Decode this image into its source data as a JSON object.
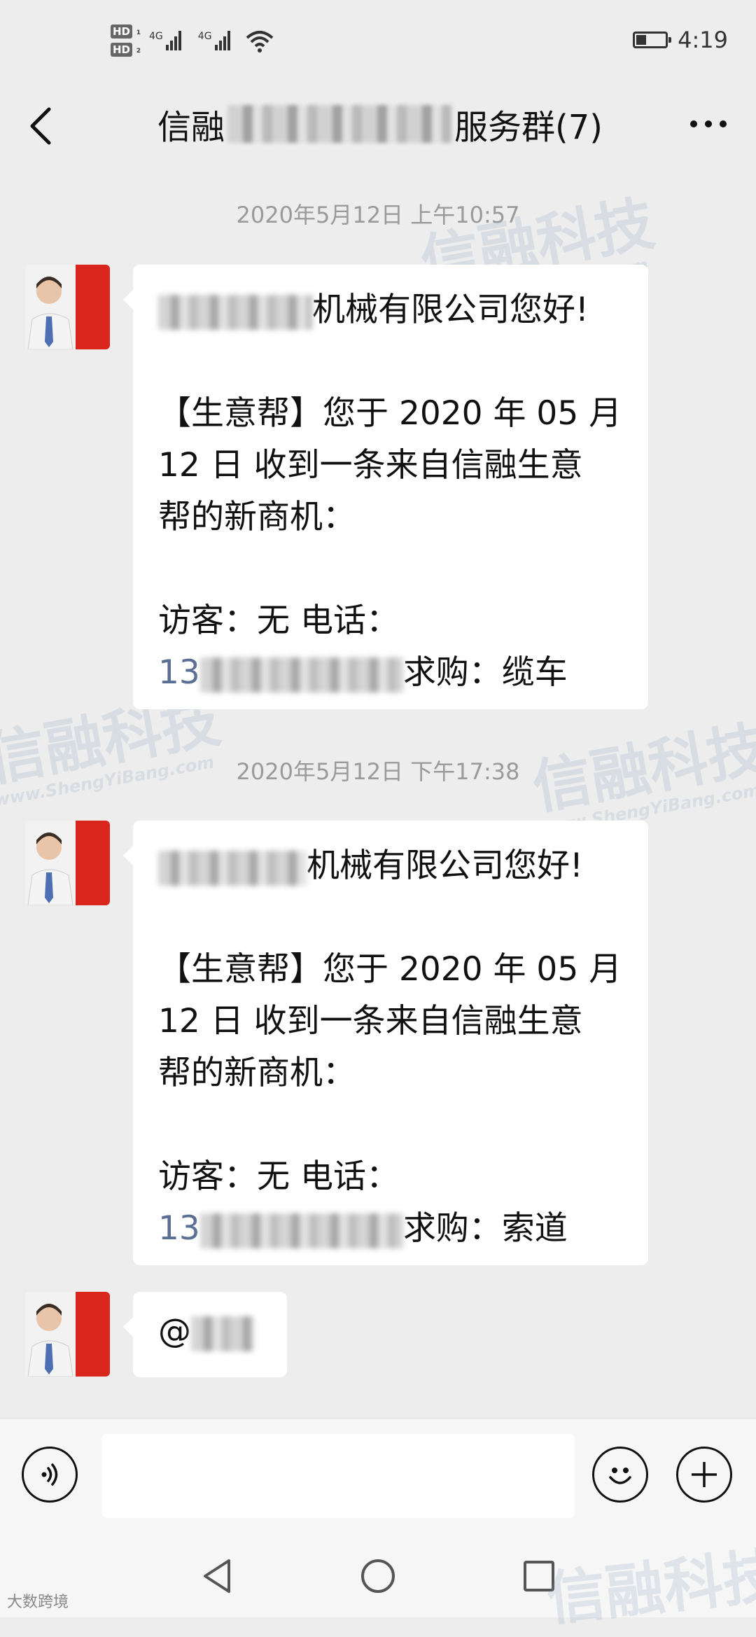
{
  "status_bar": {
    "hd1": "HD",
    "hd1_index": "1",
    "hd2": "HD",
    "hd2_index": "2",
    "net1": "4G",
    "net2": "4G",
    "time": "4:19",
    "battery_level": 0.35
  },
  "header": {
    "title_prefix": "信融",
    "title_suffix": "服务群(7)"
  },
  "messages": [
    {
      "timestamp": "2020年5月12日 上午10:57",
      "line1_suffix": "机械有限公司您好!",
      "line2": "【生意帮】您于 2020 年 05 月",
      "line3": "12 日  收到一条来自信融生意",
      "line4": "帮的新商机：",
      "line5": "访客：无  电话：",
      "phone_prefix": "13",
      "purchase": "求购：缆车"
    },
    {
      "timestamp": "2020年5月12日 下午17:38",
      "line1_suffix": "机械有限公司您好!",
      "line2": "【生意帮】您于 2020 年 05 月",
      "line3": "12 日  收到一条来自信融生意",
      "line4": "帮的新商机：",
      "line5": "访客：无  电话：",
      "phone_prefix": "13",
      "purchase": "求购：索道"
    },
    {
      "mention": "@"
    }
  ],
  "watermark": {
    "text": "信融科技",
    "url": "www.ShengYiBang.com"
  },
  "footer_logo": "大数跨境"
}
